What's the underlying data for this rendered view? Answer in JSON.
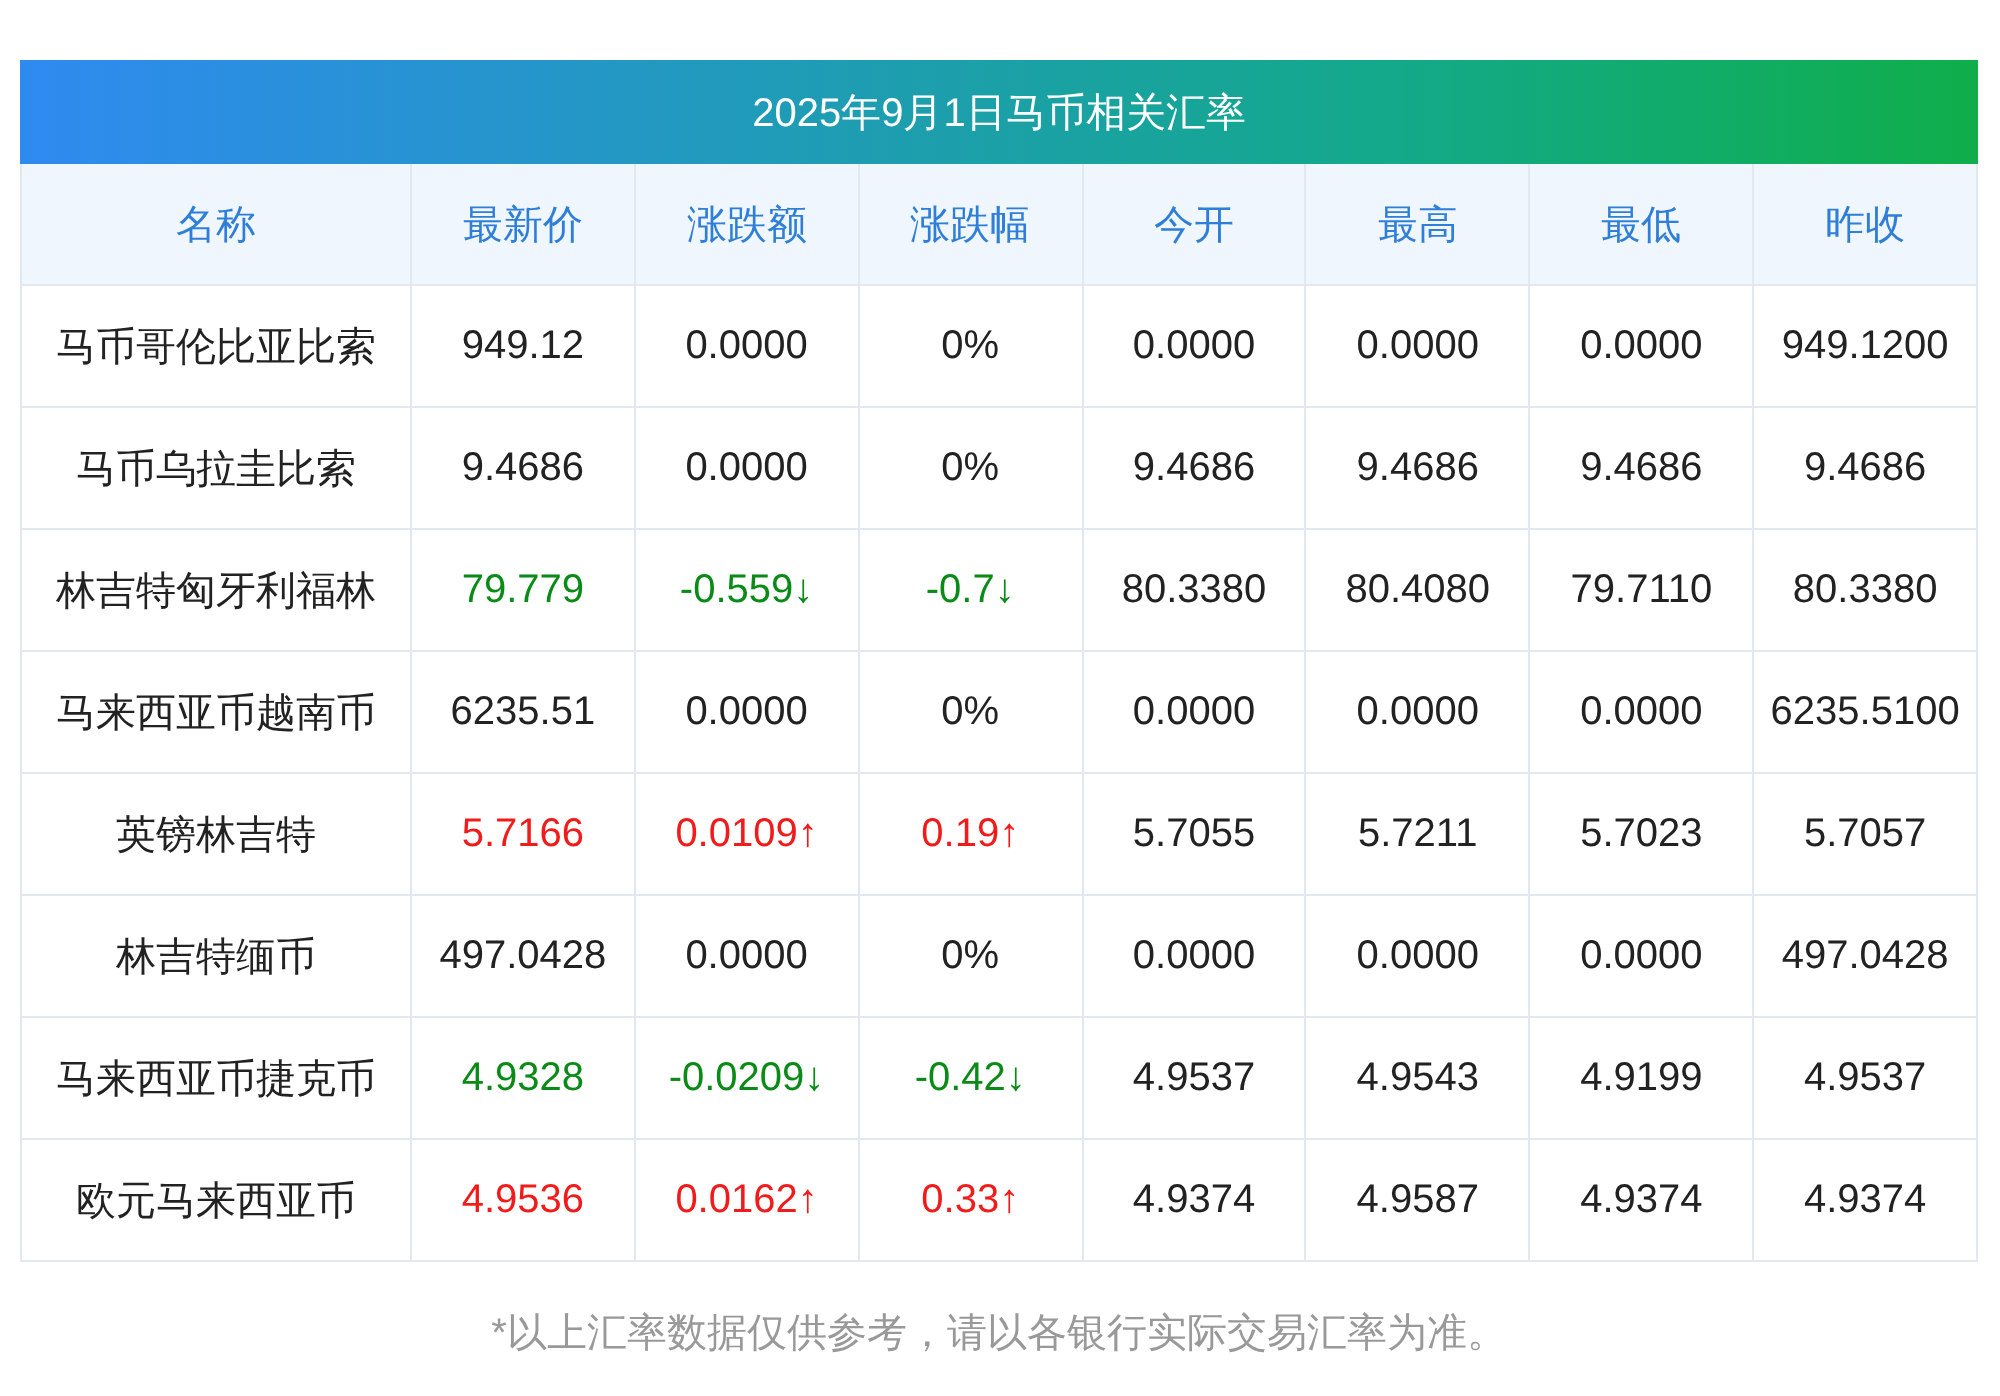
{
  "title": "2025年9月1日马币相关汇率",
  "table": {
    "columns": [
      "名称",
      "最新价",
      "涨跌额",
      "涨跌幅",
      "今开",
      "最高",
      "最低",
      "昨收"
    ],
    "rows": [
      {
        "color": "#222222",
        "cells": [
          "马币哥伦比亚比索",
          "949.12",
          "0.0000",
          "0%",
          "0.0000",
          "0.0000",
          "0.0000",
          "949.1200"
        ]
      },
      {
        "color": "#222222",
        "cells": [
          "马币乌拉圭比索",
          "9.4686",
          "0.0000",
          "0%",
          "9.4686",
          "9.4686",
          "9.4686",
          "9.4686"
        ]
      },
      {
        "color": "#0a8a16",
        "cells": [
          "林吉特匈牙利福林",
          "79.779",
          "-0.559↓",
          "-0.7↓",
          "80.3380",
          "80.4080",
          "79.7110",
          "80.3380"
        ]
      },
      {
        "color": "#222222",
        "cells": [
          "马来西亚币越南币",
          "6235.51",
          "0.0000",
          "0%",
          "0.0000",
          "0.0000",
          "0.0000",
          "6235.5100"
        ]
      },
      {
        "color": "#f21b1b",
        "cells": [
          "英镑林吉特",
          "5.7166",
          "0.0109↑",
          "0.19↑",
          "5.7055",
          "5.7211",
          "5.7023",
          "5.7057"
        ]
      },
      {
        "color": "#222222",
        "cells": [
          "林吉特缅币",
          "497.0428",
          "0.0000",
          "0%",
          "0.0000",
          "0.0000",
          "0.0000",
          "497.0428"
        ]
      },
      {
        "color": "#0a8a16",
        "cells": [
          "马来西亚币捷克币",
          "4.9328",
          "-0.0209↓",
          "-0.42↓",
          "4.9537",
          "4.9543",
          "4.9199",
          "4.9537"
        ]
      },
      {
        "color": "#f21b1b",
        "cells": [
          "欧元马来西亚币",
          "4.9536",
          "0.0162↑",
          "0.33↑",
          "4.9374",
          "4.9587",
          "4.9374",
          "4.9374"
        ]
      }
    ]
  },
  "footnote": "*以上汇率数据仅供参考，请以各银行实际交易汇率为准。"
}
